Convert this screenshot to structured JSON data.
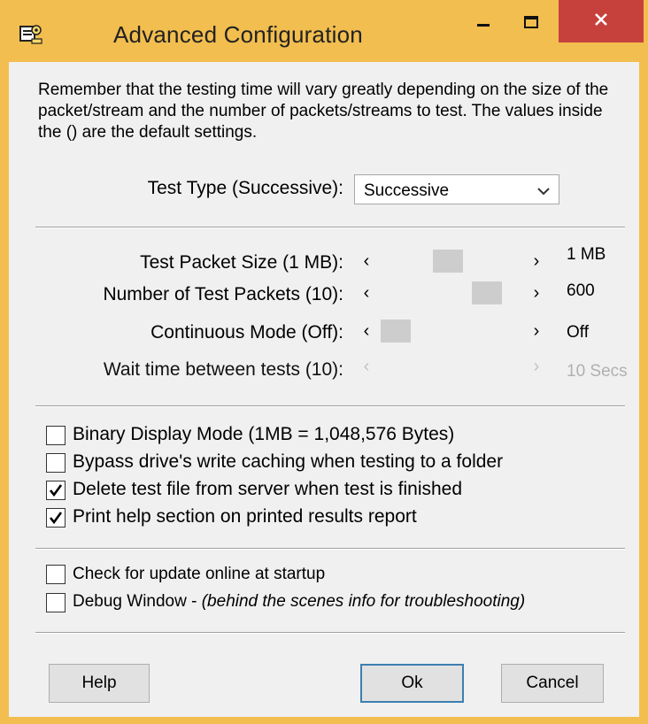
{
  "window": {
    "title": "Advanced Configuration",
    "icon": "app-gear-icon",
    "controls": {
      "minimize": "minimize-icon",
      "maximize": "maximize-icon",
      "close": "close-icon"
    }
  },
  "intro_text": "Remember that the testing time will vary greatly depending on the size of the packet/stream and the number of packets/streams to test.  The values inside the () are the default settings.",
  "test_type": {
    "label": "Test Type (Successive):",
    "selected": "Successive"
  },
  "sliders": [
    {
      "label": "Test Packet Size (1 MB):",
      "value": "1 MB",
      "enabled": true,
      "position_fraction": 0.5
    },
    {
      "label": "Number of Test Packets (10):",
      "value": "600",
      "enabled": true,
      "position_fraction": 0.9
    },
    {
      "label": "Continuous Mode (Off):",
      "value": "Off",
      "enabled": true,
      "position_fraction": 0.0
    },
    {
      "label": "Wait time between tests (10):",
      "value": "10 Secs",
      "enabled": false,
      "position_fraction": null
    }
  ],
  "options": [
    {
      "label": "Binary Display Mode (1MB = 1,048,576 Bytes)",
      "checked": false
    },
    {
      "label": "Bypass drive's write caching when testing to a folder",
      "checked": false
    },
    {
      "label": "Delete test file from server when test is finished",
      "checked": true
    },
    {
      "label": "Print help section on printed results report",
      "checked": true
    }
  ],
  "misc": {
    "update_label": "Check for update online at startup",
    "update_checked": false,
    "debug_label": "Debug Window - ",
    "debug_note": "(behind the scenes info for troubleshooting)",
    "debug_checked": false
  },
  "buttons": {
    "help": "Help",
    "ok": "Ok",
    "cancel": "Cancel"
  },
  "colors": {
    "title_bar": "#f2be4f",
    "close": "#c7413c",
    "client": "#f0f0f0",
    "default_button_border": "#3c7fb1"
  }
}
